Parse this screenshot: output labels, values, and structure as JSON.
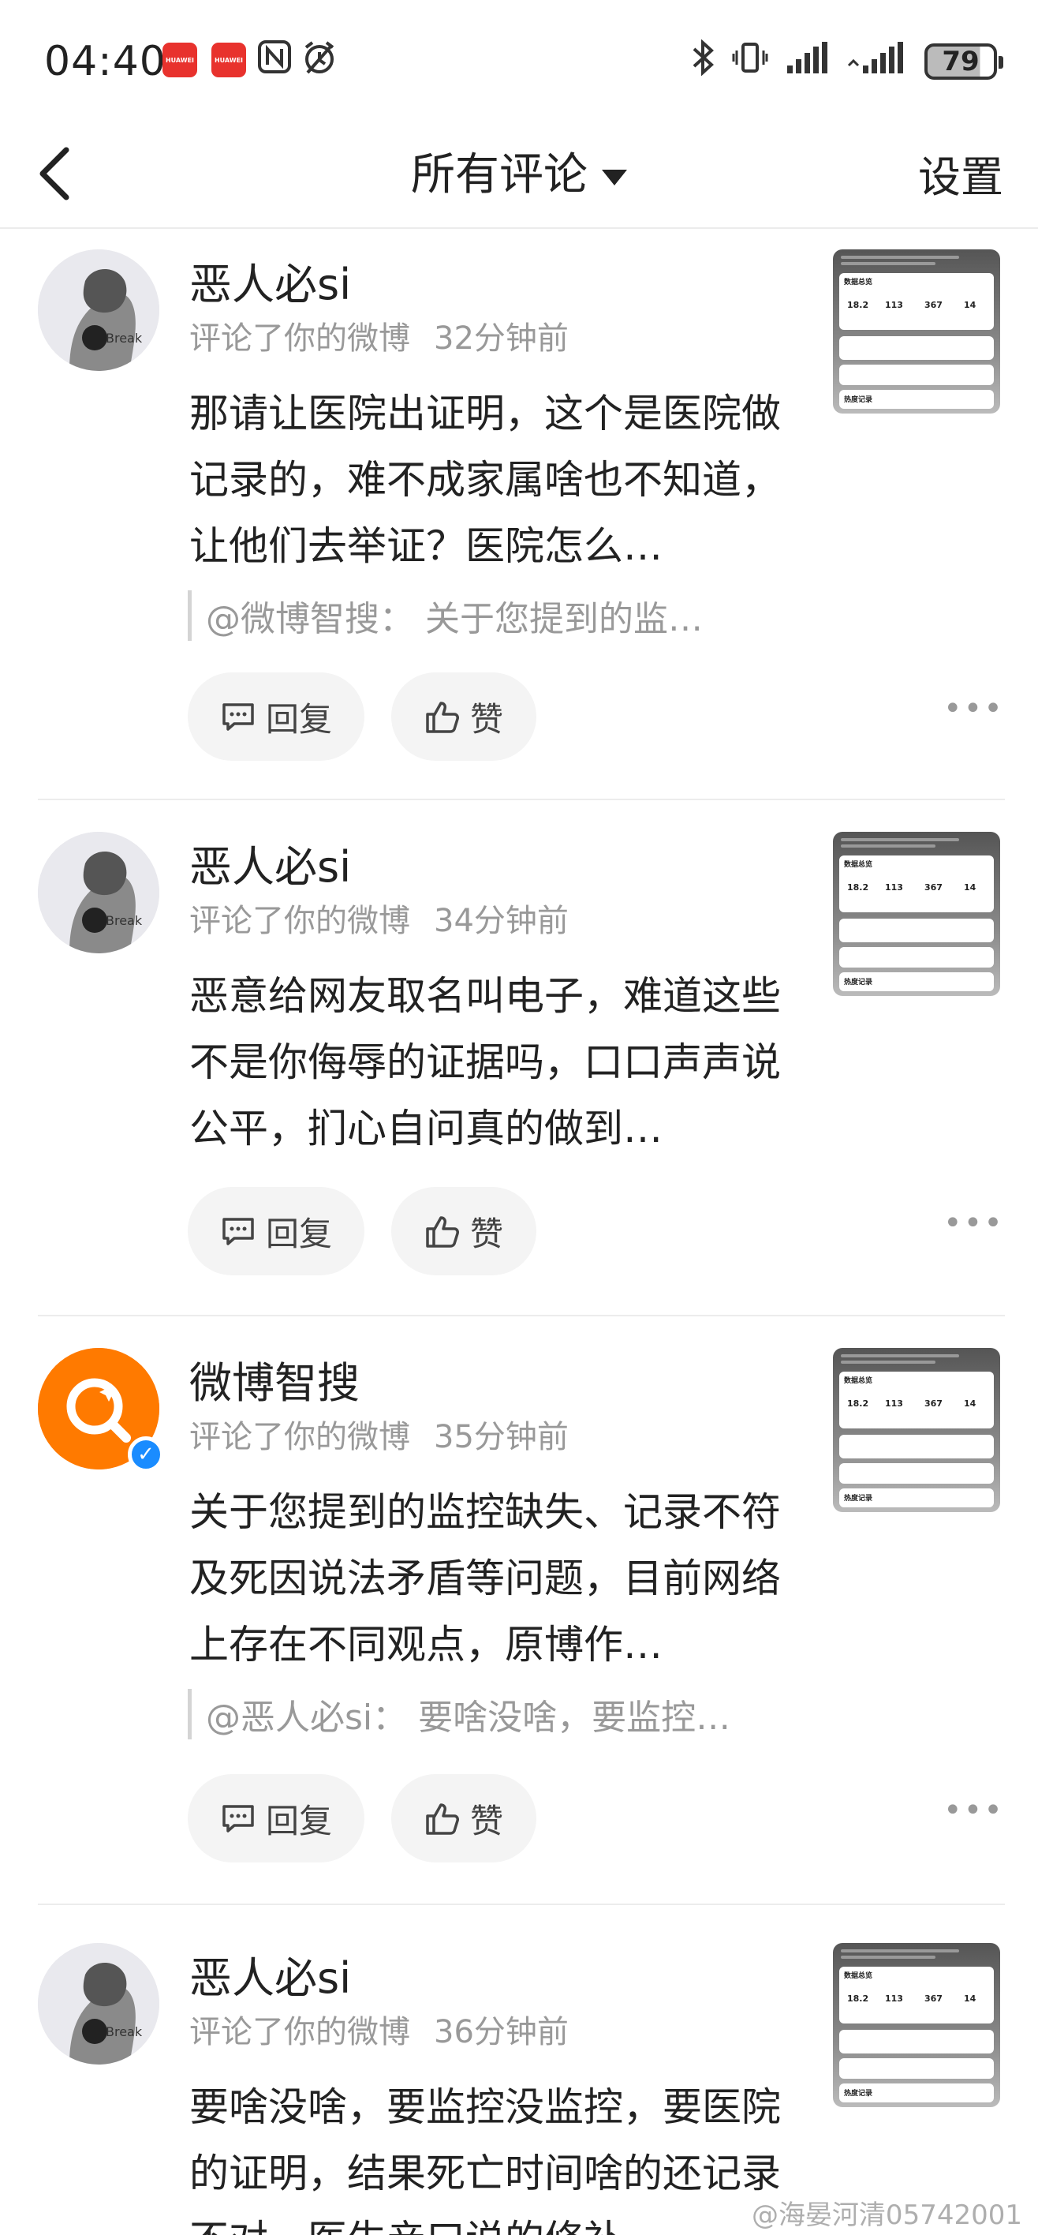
{
  "status_bar": {
    "time": "04:40",
    "app_icons": [
      "huawei-app-icon",
      "huawei-app-icon",
      "nfc-icon",
      "alarm-icon"
    ],
    "app_icon_label": "HUAWEI",
    "battery": "79"
  },
  "nav": {
    "title": "所有评论",
    "settings_label": "设置"
  },
  "comments": [
    {
      "user": "恶人必si",
      "action": "评论了你的微博",
      "time_ago": "32分钟前",
      "text": "那请让医院出证明，这个是医院做记录的，难不成家属啥也不知道，让他们去举证？医院怎么…",
      "quote": "@微博智搜： 关于您提到的监…",
      "reply_label": "回复",
      "like_label": "赞",
      "avatar_text": "Break"
    },
    {
      "user": "恶人必si",
      "action": "评论了你的微博",
      "time_ago": "34分钟前",
      "text": "恶意给网友取名叫电子，难道这些不是你侮辱的证据吗，口口声声说公平，扪心自问真的做到…",
      "quote": "",
      "reply_label": "回复",
      "like_label": "赞",
      "avatar_text": "Break"
    },
    {
      "user": "微博智搜",
      "action": "评论了你的微博",
      "time_ago": "35分钟前",
      "text": "关于您提到的监控缺失、记录不符及死因说法矛盾等问题，目前网络上存在不同观点，原博作…",
      "quote": "@恶人必si： 要啥没啥，要监控…",
      "reply_label": "回复",
      "like_label": "赞",
      "avatar_text": ""
    },
    {
      "user": "恶人必si",
      "action": "评论了你的微博",
      "time_ago": "36分钟前",
      "text": "要啥没啥，要监控没监控，要医院的证明，结果死亡时间啥的还记录不对，医生亲口说的修补",
      "quote": "",
      "reply_label": "回复",
      "like_label": "赞",
      "avatar_text": "Break"
    }
  ],
  "thumbnail": {
    "header_title": "数据总览",
    "values": [
      "18.2",
      "113",
      "367",
      "14"
    ],
    "section_label": "热度记录"
  },
  "watermark": "@海晏河清05742001",
  "colors": {
    "accent_orange": "#ff7a00",
    "verified_blue": "#1a8cff",
    "meta_gray": "#999999"
  }
}
